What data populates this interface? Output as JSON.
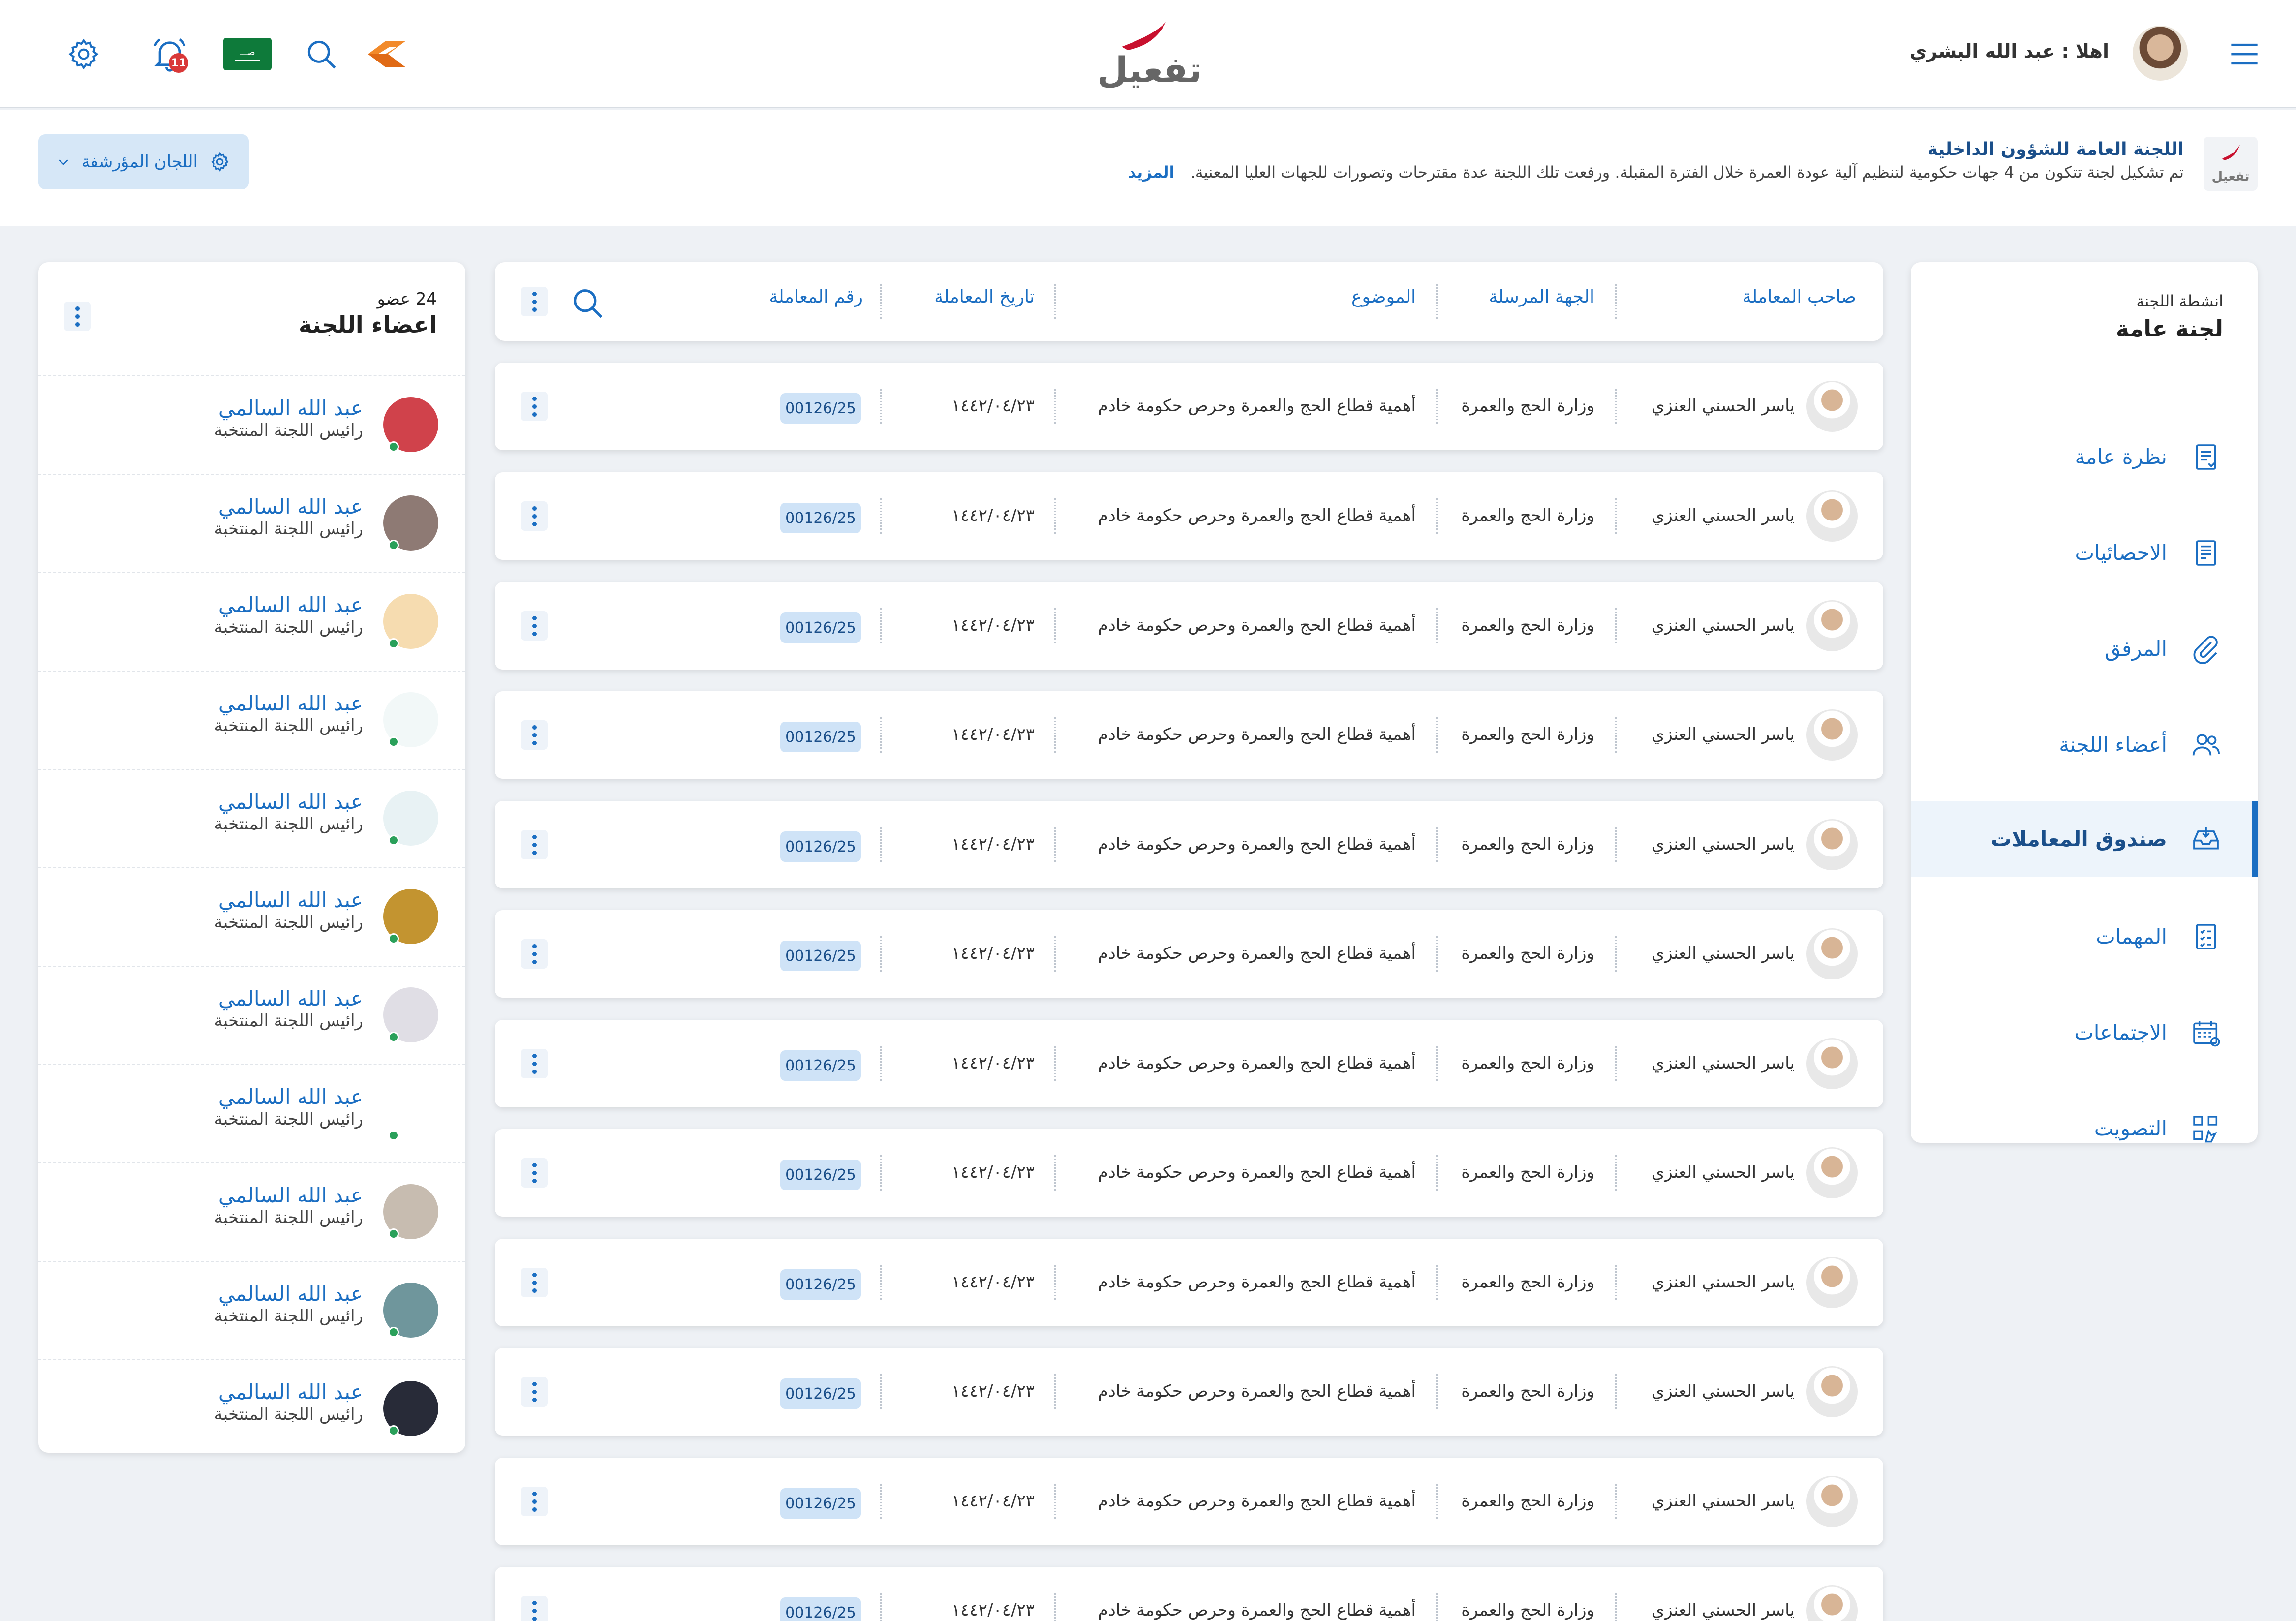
{
  "header": {
    "greeting": "اهلا : عبد الله البشري",
    "logo_text": "تفعيل",
    "notification_count": "11",
    "flag_text": "صـــ"
  },
  "banner": {
    "logo_text": "تفعيل",
    "title": "اللجنة العامة للشؤون الداخلية",
    "description": "تم تشكيل لجنة تتكون من 4 جهات حكومية لتنظيم آلية عودة العمرة خلال الفترة المقبلة. ورفعت تلك اللجنة عدة مقترحات وتصورات للجهات العليا المعنية.",
    "more": "المزيد",
    "archived_committees": "اللجان المؤرشفة"
  },
  "activities": {
    "subtitle": "انشطة اللجنة",
    "title": "لجنة عامة",
    "items": [
      {
        "label": "نظرة عامة",
        "icon": "overview-icon"
      },
      {
        "label": "الاحصائيات",
        "icon": "statistics-icon"
      },
      {
        "label": "المرفق",
        "icon": "attachment-icon"
      },
      {
        "label": "أعضاء اللجنة",
        "icon": "members-icon"
      },
      {
        "label": "صندوق المعاملات",
        "icon": "inbox-icon"
      },
      {
        "label": "المهمات",
        "icon": "tasks-icon"
      },
      {
        "label": "الاجتماعات",
        "icon": "calendar-icon"
      },
      {
        "label": "التصويت",
        "icon": "vote-icon"
      }
    ]
  },
  "table": {
    "headers": {
      "owner": "صاحب المعاملة",
      "sender": "الجهة المرسلة",
      "subject": "الموضوع",
      "date": "تاريخ المعاملة",
      "number": "رقم المعاملة"
    },
    "rows": [
      {
        "owner": "ياسر الحسني العنزي",
        "sender": "وزارة الحج والعمرة",
        "subject": "أهمية قطاع الحج والعمرة وحرص حكومة خادم",
        "date": "١٤٤٢/٠٤/٢٣",
        "number": "00126/25"
      },
      {
        "owner": "ياسر الحسني العنزي",
        "sender": "وزارة الحج والعمرة",
        "subject": "أهمية قطاع الحج والعمرة وحرص حكومة خادم",
        "date": "١٤٤٢/٠٤/٢٣",
        "number": "00126/25"
      },
      {
        "owner": "ياسر الحسني العنزي",
        "sender": "وزارة الحج والعمرة",
        "subject": "أهمية قطاع الحج والعمرة وحرص حكومة خادم",
        "date": "١٤٤٢/٠٤/٢٣",
        "number": "00126/25"
      },
      {
        "owner": "ياسر الحسني العنزي",
        "sender": "وزارة الحج والعمرة",
        "subject": "أهمية قطاع الحج والعمرة وحرص حكومة خادم",
        "date": "١٤٤٢/٠٤/٢٣",
        "number": "00126/25"
      },
      {
        "owner": "ياسر الحسني العنزي",
        "sender": "وزارة الحج والعمرة",
        "subject": "أهمية قطاع الحج والعمرة وحرص حكومة خادم",
        "date": "١٤٤٢/٠٤/٢٣",
        "number": "00126/25"
      },
      {
        "owner": "ياسر الحسني العنزي",
        "sender": "وزارة الحج والعمرة",
        "subject": "أهمية قطاع الحج والعمرة وحرص حكومة خادم",
        "date": "١٤٤٢/٠٤/٢٣",
        "number": "00126/25"
      },
      {
        "owner": "ياسر الحسني العنزي",
        "sender": "وزارة الحج والعمرة",
        "subject": "أهمية قطاع الحج والعمرة وحرص حكومة خادم",
        "date": "١٤٤٢/٠٤/٢٣",
        "number": "00126/25"
      },
      {
        "owner": "ياسر الحسني العنزي",
        "sender": "وزارة الحج والعمرة",
        "subject": "أهمية قطاع الحج والعمرة وحرص حكومة خادم",
        "date": "١٤٤٢/٠٤/٢٣",
        "number": "00126/25"
      },
      {
        "owner": "ياسر الحسني العنزي",
        "sender": "وزارة الحج والعمرة",
        "subject": "أهمية قطاع الحج والعمرة وحرص حكومة خادم",
        "date": "١٤٤٢/٠٤/٢٣",
        "number": "00126/25"
      },
      {
        "owner": "ياسر الحسني العنزي",
        "sender": "وزارة الحج والعمرة",
        "subject": "أهمية قطاع الحج والعمرة وحرص حكومة خادم",
        "date": "١٤٤٢/٠٤/٢٣",
        "number": "00126/25"
      },
      {
        "owner": "ياسر الحسني العنزي",
        "sender": "وزارة الحج والعمرة",
        "subject": "أهمية قطاع الحج والعمرة وحرص حكومة خادم",
        "date": "١٤٤٢/٠٤/٢٣",
        "number": "00126/25"
      },
      {
        "owner": "ياسر الحسني العنزي",
        "sender": "وزارة الحج والعمرة",
        "subject": "أهمية قطاع الحج والعمرة وحرص حكومة خادم",
        "date": "١٤٤٢/٠٤/٢٣",
        "number": "00126/25"
      }
    ]
  },
  "members": {
    "count": "24 عضو",
    "title": "اعضاء اللجنة",
    "items": [
      {
        "name": "عبد الله السالمي",
        "role": "رائيس اللجنة المنتخبة",
        "color": "#d0424b"
      },
      {
        "name": "عبد الله السالمي",
        "role": "رائيس اللجنة المنتخبة",
        "color": "#8e7a74"
      },
      {
        "name": "عبد الله السالمي",
        "role": "رائيس اللجنة المنتخبة",
        "color": "#f6dcb0"
      },
      {
        "name": "عبد الله السالمي",
        "role": "رائيس اللجنة المنتخبة",
        "color": "#f2f8f8"
      },
      {
        "name": "عبد الله السالمي",
        "role": "رائيس اللجنة المنتخبة",
        "color": "#e8f2f4"
      },
      {
        "name": "عبد الله السالمي",
        "role": "رائيس اللجنة المنتخبة",
        "color": "#c39430"
      },
      {
        "name": "عبد الله السالمي",
        "role": "رائيس اللجنة المنتخبة",
        "color": "#e0dee5"
      },
      {
        "name": "عبد الله السالمي",
        "role": "رائيس اللجنة المنتخبة",
        "color": "#ffffff"
      },
      {
        "name": "عبد الله السالمي",
        "role": "رائيس اللجنة المنتخبة",
        "color": "#c7bcb0"
      },
      {
        "name": "عبد الله السالمي",
        "role": "رائيس اللجنة المنتخبة",
        "color": "#6f969c"
      },
      {
        "name": "عبد الله السالمي",
        "role": "رائيس اللجنة المنتخبة",
        "color": "#282b38"
      }
    ]
  }
}
